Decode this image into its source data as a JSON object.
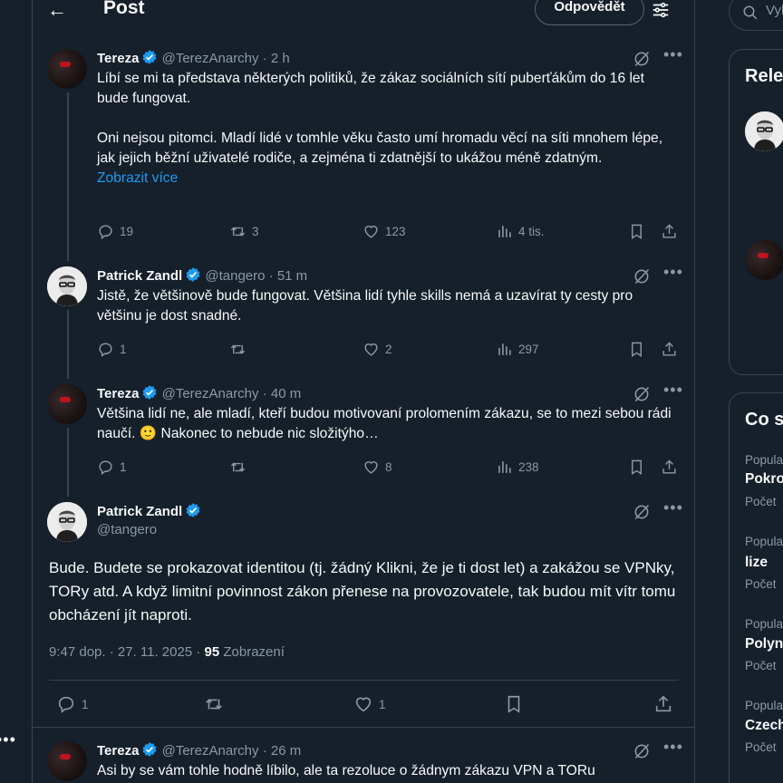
{
  "header": {
    "title": "Post",
    "reply_label": "Odpovědět"
  },
  "search": {
    "placeholder": "Vyh"
  },
  "replies": [
    {
      "name": "Tereza",
      "handle": "@TerezAnarchy",
      "time": "2 h",
      "text_p1": "Líbí se mi ta představa některých politiků, že zákaz sociálních sítí puberťákům do 16 let bude fungovat.",
      "text_p2": "Oni nejsou pitomci. Mladí lidé v tomhle věku často umí hromadu věcí na síti mnohem lépe, jak jejich běžní uživatelé rodiče, a zejména ti zdatnější to ukážou méně zdatným.",
      "show_more": "Zobrazit více",
      "replies": "19",
      "reposts": "3",
      "likes": "123",
      "views": "4 tis."
    },
    {
      "name": "Patrick Zandl",
      "handle": "@tangero",
      "time": "51 m",
      "text": "Jistě, že většinově bude fungovat. Většina lidí tyhle skills nemá a uzavírat ty cesty pro většinu je dost snadné.",
      "replies": "1",
      "reposts": "",
      "likes": "2",
      "views": "297"
    },
    {
      "name": "Tereza",
      "handle": "@TerezAnarchy",
      "time": "40 m",
      "text": "Většina lidí ne, ale mladí, kteří budou motivovaní prolomením zákazu, se to mezi sebou rádi naučí. 🙂 Nakonec to nebude nic složitýho…",
      "replies": "1",
      "reposts": "",
      "likes": "8",
      "views": "238"
    }
  ],
  "focal": {
    "name": "Patrick Zandl",
    "handle": "@tangero",
    "text": "Bude. Budete se prokazovat identitou (tj. žádný Klikni, že je ti dost let) a zakážou se VPNky, TORy atd. A když limitní povinnost zákon přenese na provozovatele, tak budou mít vítr tomu obcházení jít naproti.",
    "datetime": "9:47 dop. · 27. 11. 2025 · ",
    "views_count": "95",
    "views_label": " Zobrazení",
    "replies": "1",
    "likes": "1"
  },
  "next_reply": {
    "name": "Tereza",
    "handle": "@TerezAnarchy",
    "time": "26 m",
    "text": "Asi by se vám tohle hodně líbilo, ale ta rezoluce o žádnym zákazu VPN a TORu"
  },
  "right": {
    "relevant_title": "Rele",
    "trends_title": "Co s",
    "trends": [
      {
        "ctx": "Popula",
        "name": "Pokro",
        "count": "Počet"
      },
      {
        "ctx": "Popula",
        "name": "lize",
        "count": "Počet"
      },
      {
        "ctx": "Popula",
        "name": "Polyn",
        "count": "Počet"
      },
      {
        "ctx": "Popula",
        "name": "Czech",
        "count": "Počet"
      }
    ]
  },
  "colors": {
    "background": "#15202b",
    "accent": "#1d9bf0",
    "muted": "#8b98a5",
    "border": "#38444d"
  }
}
